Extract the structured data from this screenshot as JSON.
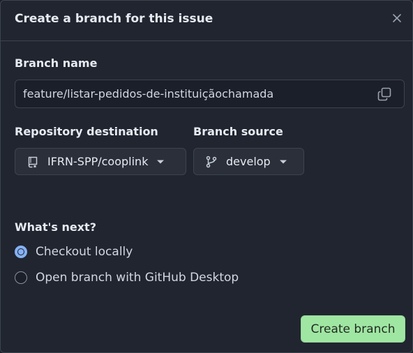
{
  "dialog": {
    "title": "Create a branch for this issue",
    "close_icon": "x-icon"
  },
  "branch_name": {
    "label": "Branch name",
    "value": "feature/listar-pedidos-de-instituiçãochamada",
    "copy_icon": "copy-icon"
  },
  "repository": {
    "label": "Repository destination",
    "value": "IFRN-SPP/cooplink",
    "icon": "repo-icon"
  },
  "branch_source": {
    "label": "Branch source",
    "value": "develop",
    "icon": "git-branch-icon"
  },
  "whats_next": {
    "label": "What's next?",
    "options": [
      {
        "label": "Checkout locally",
        "checked": true
      },
      {
        "label": "Open branch with GitHub Desktop",
        "checked": false
      }
    ]
  },
  "actions": {
    "create_label": "Create branch"
  },
  "colors": {
    "accent_radio": "#85b1f4",
    "primary_button": "#a0e6a3",
    "background": "#212530"
  }
}
